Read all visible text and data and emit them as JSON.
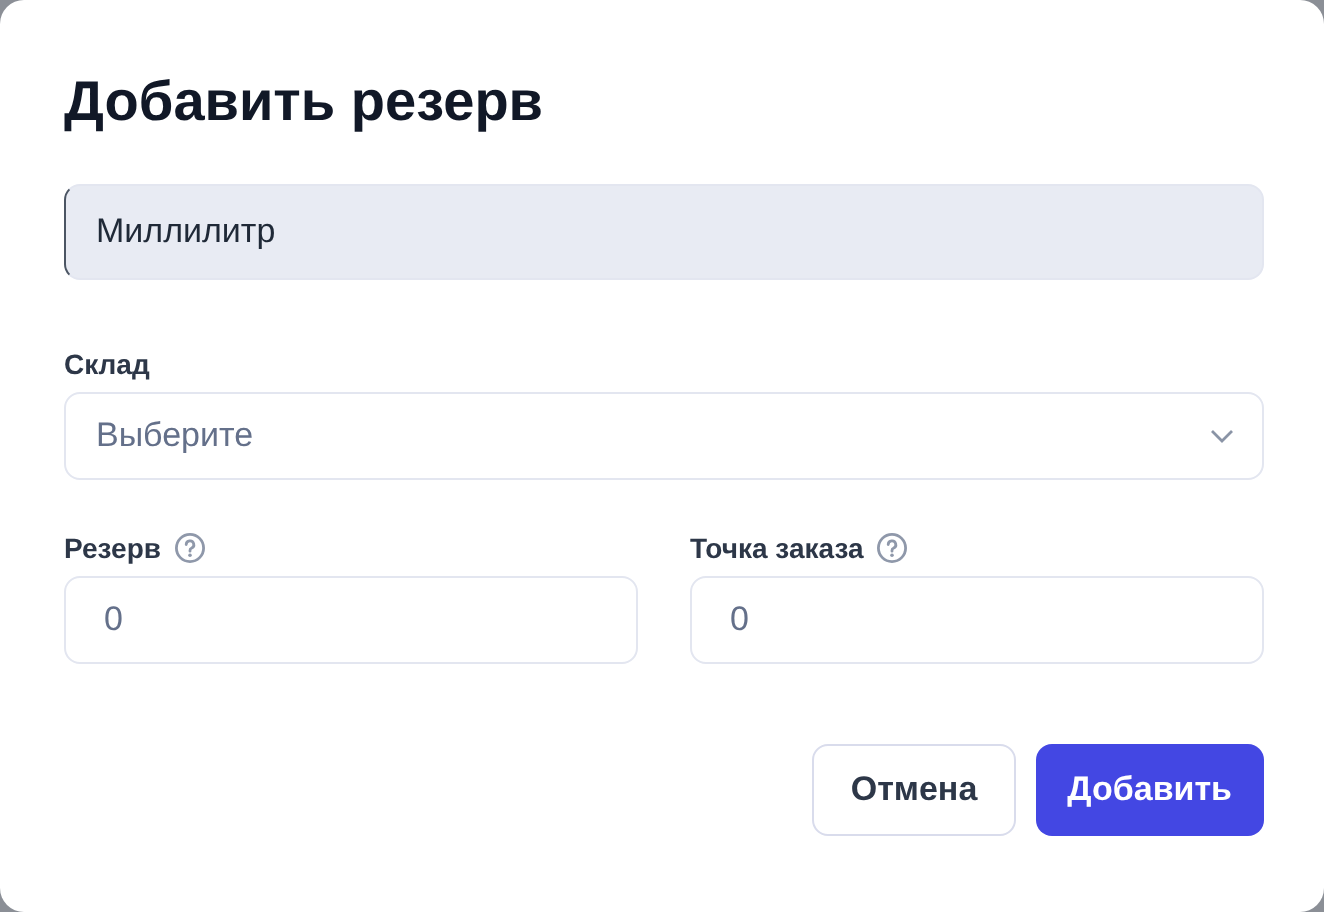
{
  "dialog": {
    "title": "Добавить резерв",
    "unit_field": {
      "value": "Миллилитр",
      "disabled": true
    },
    "warehouse": {
      "label": "Склад",
      "placeholder": "Выберите"
    },
    "number_fields": [
      {
        "label": "Резерв",
        "value": "0"
      },
      {
        "label": "Точка заказа",
        "value": "0"
      }
    ],
    "buttons": [
      {
        "label": "Отмена",
        "kind": "secondary"
      },
      {
        "label": "Добавить",
        "kind": "primary"
      }
    ]
  }
}
